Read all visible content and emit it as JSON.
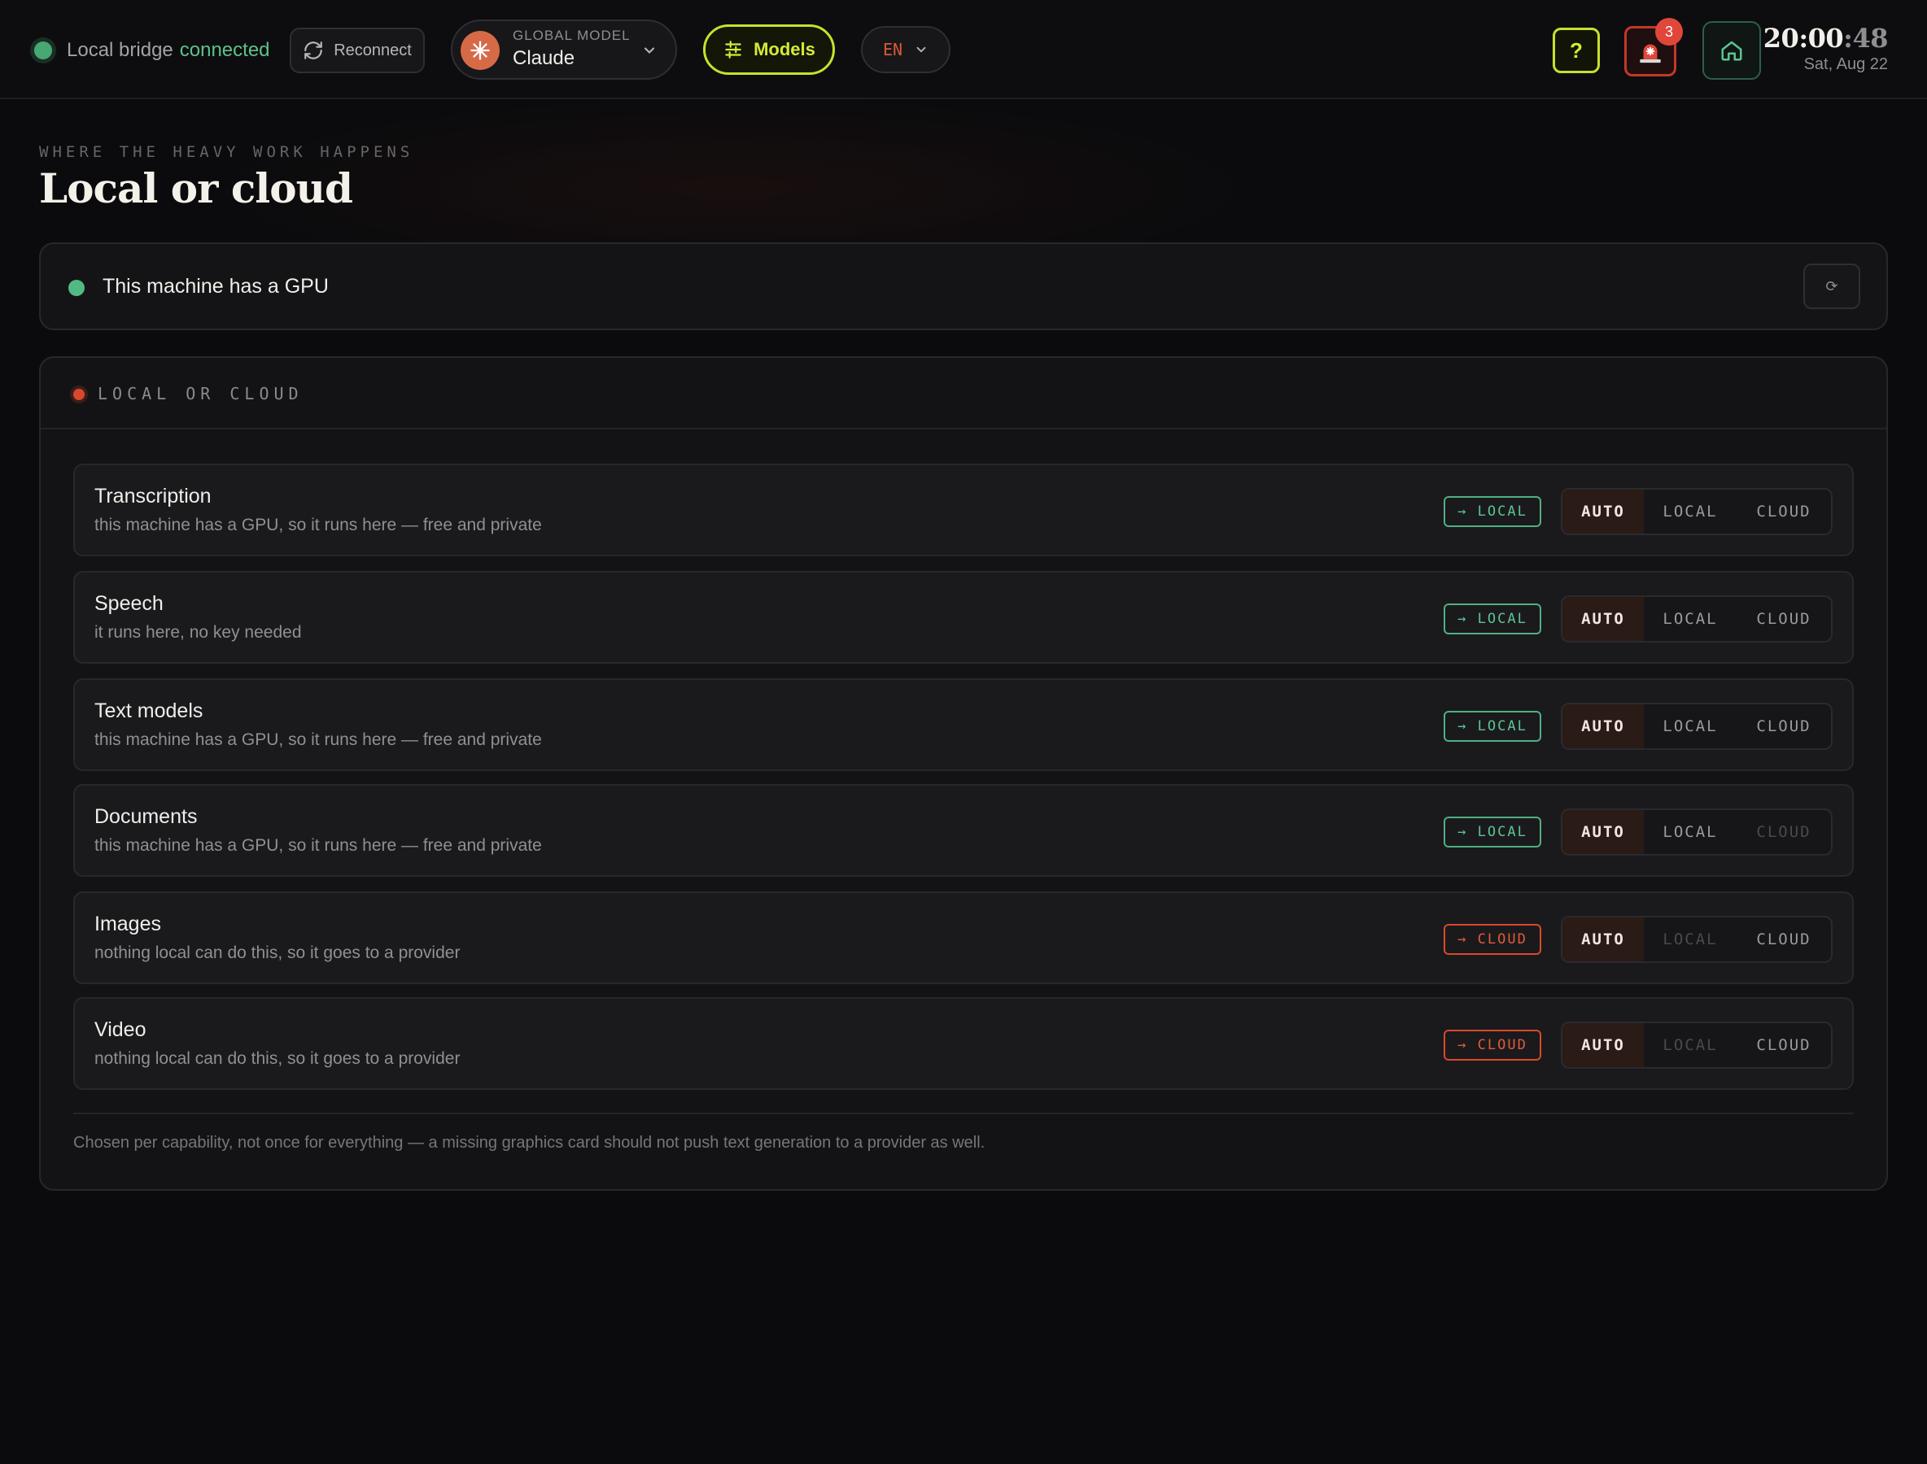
{
  "topbar": {
    "bridge_label": "Local bridge",
    "bridge_status": "connected",
    "reconnect_label": "Reconnect",
    "model_caption": "GLOBAL MODEL",
    "model_name": "Claude",
    "models_label": "Models",
    "language": "EN",
    "help_label": "?",
    "alert_count": "3",
    "clock_hm": "20:00",
    "clock_sec": ":48",
    "date": "Sat, Aug 22"
  },
  "page": {
    "eyebrow": "WHERE THE HEAVY WORK HAPPENS",
    "title": "Local or cloud"
  },
  "gpu": {
    "status_text": "This machine has a GPU",
    "refresh_icon": "⟳"
  },
  "section": {
    "label": "LOCAL OR CLOUD",
    "footer_note": "Chosen per capability, not once for everything — a missing graphics card should not push text generation to a provider as well."
  },
  "options": {
    "auto": "AUTO",
    "local": "LOCAL",
    "cloud": "CLOUD"
  },
  "capabilities": [
    {
      "name": "Transcription",
      "desc": "this machine has a GPU, so it runs here — free and private",
      "route": "→ LOCAL",
      "route_kind": "local",
      "selected": "AUTO",
      "local_enabled": true,
      "cloud_enabled": true
    },
    {
      "name": "Speech",
      "desc": "it runs here, no key needed",
      "route": "→ LOCAL",
      "route_kind": "local",
      "selected": "AUTO",
      "local_enabled": true,
      "cloud_enabled": true
    },
    {
      "name": "Text models",
      "desc": "this machine has a GPU, so it runs here — free and private",
      "route": "→ LOCAL",
      "route_kind": "local",
      "selected": "AUTO",
      "local_enabled": true,
      "cloud_enabled": true
    },
    {
      "name": "Documents",
      "desc": "this machine has a GPU, so it runs here — free and private",
      "route": "→ LOCAL",
      "route_kind": "local",
      "selected": "AUTO",
      "local_enabled": true,
      "cloud_enabled": false
    },
    {
      "name": "Images",
      "desc": "nothing local can do this, so it goes to a provider",
      "route": "→ CLOUD",
      "route_kind": "cloud",
      "selected": "AUTO",
      "local_enabled": false,
      "cloud_enabled": true
    },
    {
      "name": "Video",
      "desc": "nothing local can do this, so it goes to a provider",
      "route": "→ CLOUD",
      "route_kind": "cloud",
      "selected": "AUTO",
      "local_enabled": false,
      "cloud_enabled": true
    }
  ],
  "colors": {
    "accent_lime": "#c8e02c",
    "local_green": "#5cc493",
    "cloud_orange": "#e35a38",
    "alert_red": "#e0473a"
  }
}
